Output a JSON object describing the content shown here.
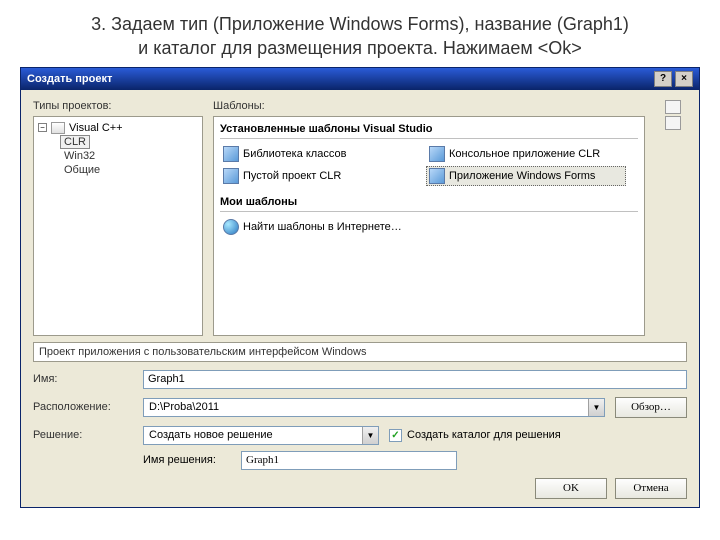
{
  "slide": {
    "caption_line1": "3. Задаем тип (Приложение Windows Forms), название (Graph1)",
    "caption_line2": "и каталог для размещения проекта. Нажимаем <Ok>"
  },
  "dialog": {
    "title": "Создать проект",
    "help": "?",
    "close": "×"
  },
  "labels": {
    "project_types": "Типы проектов:",
    "templates": "Шаблоны:"
  },
  "tree": {
    "root": "Visual C++",
    "children": [
      "CLR",
      "Win32",
      "Общие"
    ],
    "selected_index": 0
  },
  "templates": {
    "installed_header": "Установленные шаблоны Visual Studio",
    "items": [
      {
        "label": "Библиотека классов"
      },
      {
        "label": "Консольное приложение CLR"
      },
      {
        "label": "Пустой проект CLR"
      },
      {
        "label": "Приложение Windows Forms"
      }
    ],
    "selected_index": 3,
    "my_header": "Мои шаблоны",
    "search_online": "Найти шаблоны в Интернете…"
  },
  "description": "Проект приложения с пользовательским интерфейсом Windows",
  "form": {
    "name_label": "Имя:",
    "name_value": "Graph1",
    "location_label": "Расположение:",
    "location_value": "D:\\Proba\\2011",
    "browse": "Обзор…",
    "solution_label": "Решение:",
    "solution_combo": "Создать новое решение",
    "create_dir_checkbox": "Создать каталог для решения",
    "create_dir_checked": true,
    "solution_name_label": "Имя решения:",
    "solution_name_value": "Graph1"
  },
  "buttons": {
    "ok": "OK",
    "cancel": "Отмена"
  }
}
